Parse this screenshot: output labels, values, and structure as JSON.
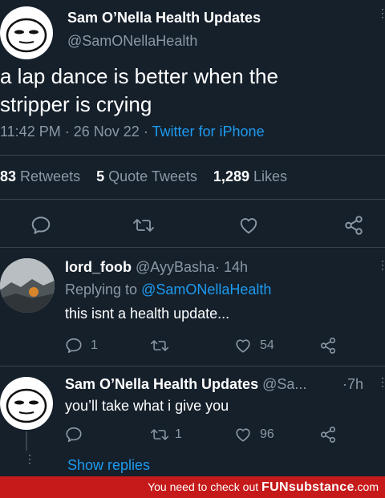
{
  "main_tweet": {
    "author": "Sam O’Nella Health Updates",
    "handle": "@SamONellaHealth",
    "text_line1": "a lap dance is better when the",
    "text_line2": "stripper is crying",
    "time": "11:42 PM",
    "date": "26 Nov 22",
    "separator": "·",
    "client": "Twitter for iPhone",
    "stats": {
      "retweets_count": "83",
      "retweets_label": "Retweets",
      "quotes_count": "5",
      "quotes_label": "Quote Tweets",
      "likes_count": "1,289",
      "likes_label": "Likes"
    },
    "action_icons": [
      "reply-icon",
      "retweet-icon",
      "like-icon",
      "share-icon"
    ]
  },
  "reply_1": {
    "author": "lord_foob",
    "handle": "@AyyBasha",
    "separator": "·",
    "time": "14h",
    "replying_prefix": "Replying to",
    "replying_to": "@SamONellaHealth",
    "text": "this isnt a health update...",
    "reply_count": "1",
    "like_count": "54"
  },
  "reply_2": {
    "author": "Sam O’Nella Health Updates",
    "handle": "@Sa...",
    "separator": "·",
    "time": "7h",
    "text": "you’ll take what i give you",
    "retweet_count": "1",
    "like_count": "96"
  },
  "show_replies": "Show replies",
  "banner": {
    "prefix": "You need to check out",
    "brand": "FUNsubstance",
    "suffix": ".com"
  },
  "colors": {
    "background": "#15202b",
    "muted": "#8b98a5",
    "link": "#1d9bf0",
    "banner": "#c61a1a"
  }
}
